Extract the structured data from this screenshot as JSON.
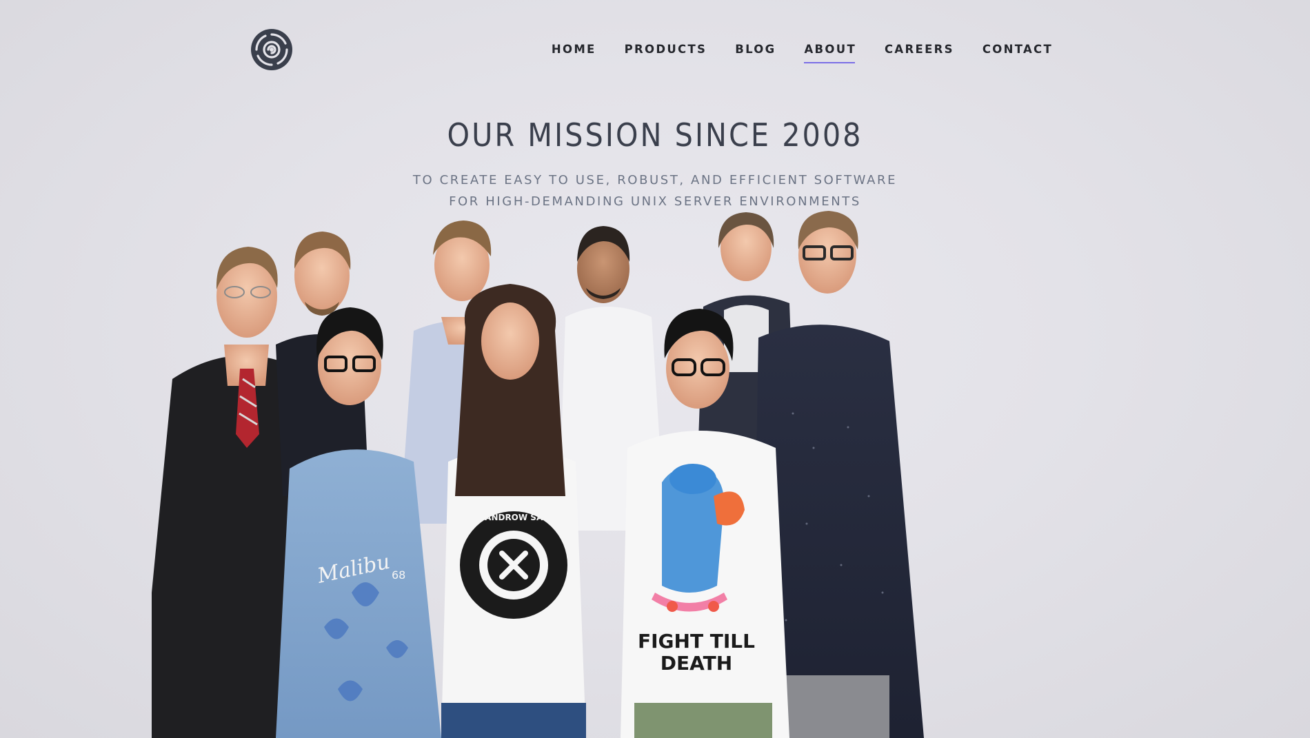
{
  "header": {
    "logo_icon": "spiral-logo-icon",
    "nav": [
      {
        "label": "HOME",
        "active": false
      },
      {
        "label": "PRODUCTS",
        "active": false
      },
      {
        "label": "BLOG",
        "active": false
      },
      {
        "label": "ABOUT",
        "active": true
      },
      {
        "label": "CAREERS",
        "active": false
      },
      {
        "label": "CONTACT",
        "active": false
      }
    ],
    "active_underline_color": "#7a6ee6"
  },
  "hero": {
    "title": "OUR MISSION SINCE 2008",
    "subtitle_line1": "TO CREATE EASY TO USE, ROBUST, AND EFFICIENT SOFTWARE",
    "subtitle_line2": "FOR HIGH-DEMANDING UNIX SERVER ENVIRONMENTS"
  },
  "photo": {
    "subject": "team-group-photo",
    "member_count": 9,
    "shirt_texts": {
      "malibu": "Malibu",
      "malibu_number": "68",
      "sandro_ring": "HERE ANDROW SANDRO",
      "fight_line1": "FIGHT TILL",
      "fight_line2": "DEATH"
    }
  },
  "colors": {
    "background": "#e3e2e8",
    "title": "#3a3f4c",
    "subtitle": "#6b7384",
    "nav_text": "#25272d"
  }
}
